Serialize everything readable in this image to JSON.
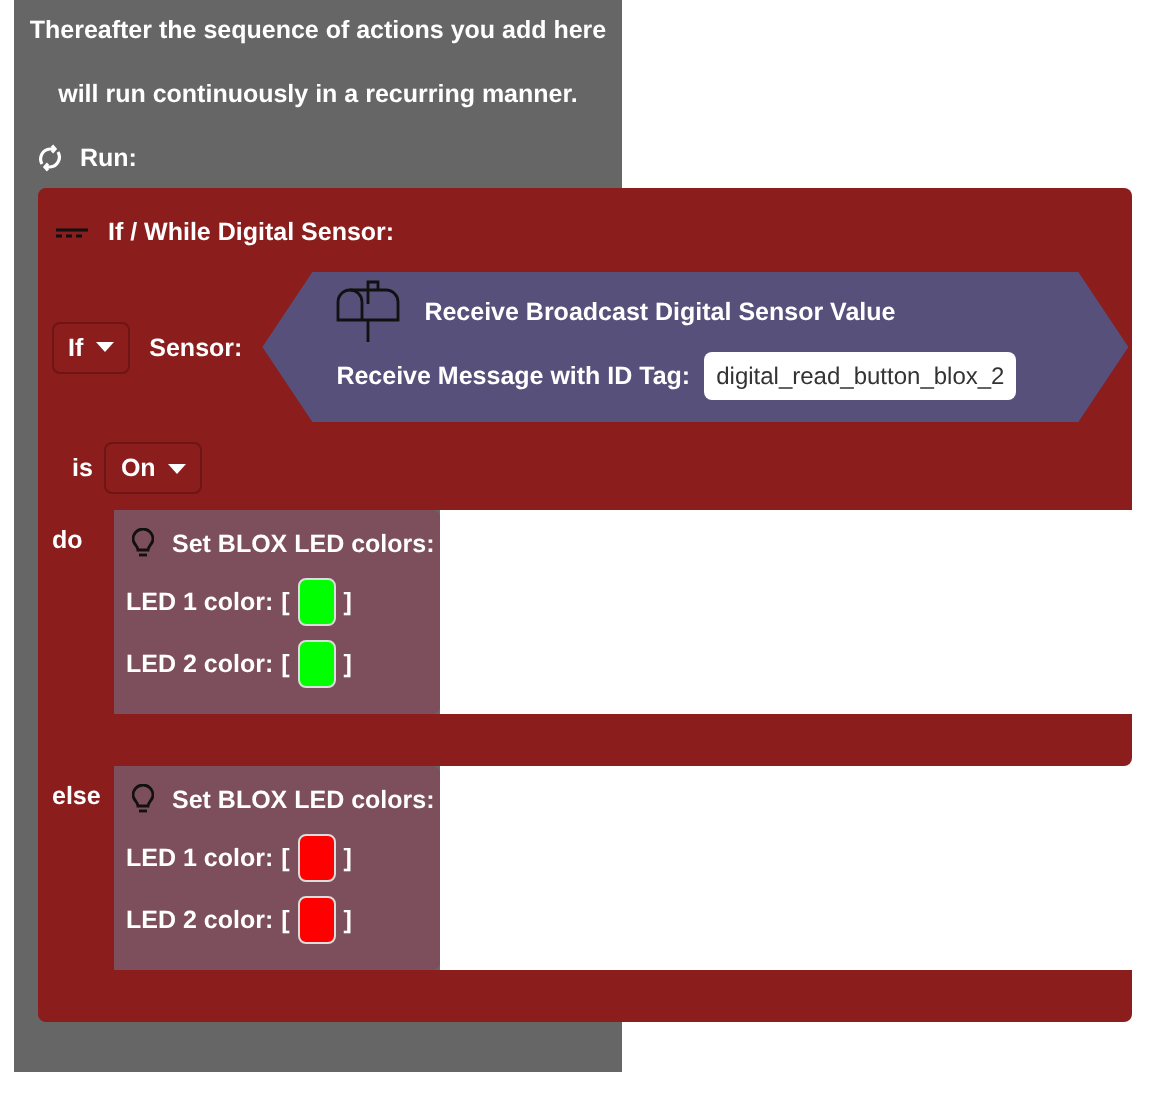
{
  "intro_lines": [
    "Thereafter the sequence of actions you add here",
    "will run continuously in a recurring manner."
  ],
  "run_label": "Run:",
  "block": {
    "title": "If / While Digital Sensor:",
    "mode": "If",
    "sensor_label": "Sensor:",
    "sensor": {
      "title": "Receive Broadcast Digital Sensor Value",
      "message_label": "Receive Message with ID Tag:",
      "id_tag": "digital_read_button_blox_2"
    },
    "is_label": "is",
    "state": "On",
    "branches": [
      {
        "label": "do",
        "action": {
          "title": "Set BLOX LED colors:",
          "leds": [
            {
              "label": "LED 1 color:",
              "open": "[",
              "close": "]",
              "color": "#00ff00"
            },
            {
              "label": "LED 2 color:",
              "open": "[",
              "close": "]",
              "color": "#00ff00"
            }
          ]
        }
      },
      {
        "label": "else",
        "action": {
          "title": "Set BLOX LED colors:",
          "leds": [
            {
              "label": "LED 1 color:",
              "open": "[",
              "close": "]",
              "color": "#ff0000"
            },
            {
              "label": "LED 2 color:",
              "open": "[",
              "close": "]",
              "color": "#ff0000"
            }
          ]
        }
      }
    ]
  }
}
